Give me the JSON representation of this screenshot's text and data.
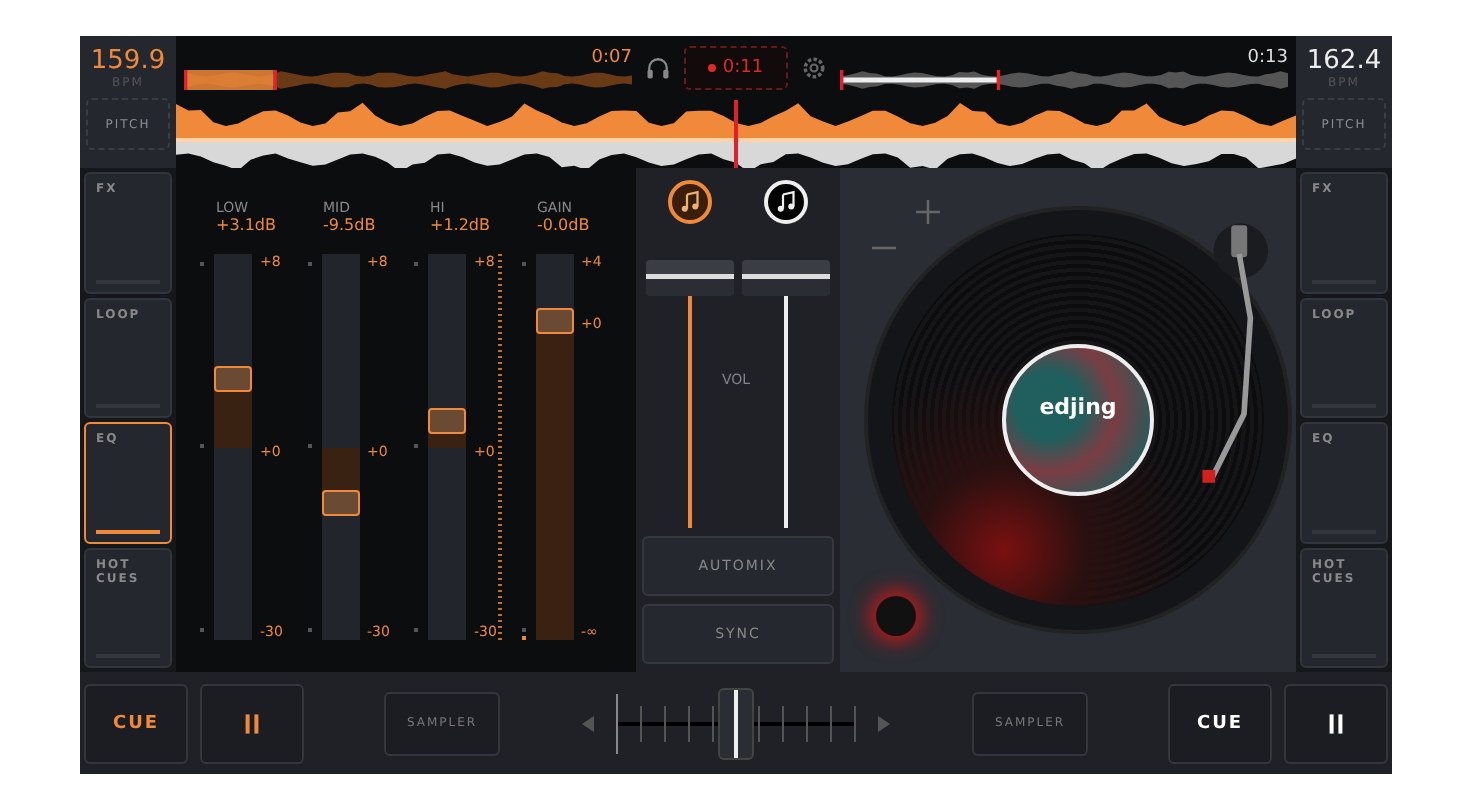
{
  "deck_a": {
    "bpm": "159.9",
    "bpm_unit": "BPM",
    "pitch": "PITCH",
    "time": "0:07",
    "level": 0.2
  },
  "deck_b": {
    "bpm": "162.4",
    "bpm_unit": "BPM",
    "pitch": "PITCH",
    "time": "0:13",
    "level": 0.35
  },
  "record": {
    "time": "0:11"
  },
  "left_tabs": [
    {
      "label": "FX",
      "selected": false
    },
    {
      "label": "LOOP",
      "selected": false
    },
    {
      "label": "EQ",
      "selected": true
    },
    {
      "label": "HOT CUES",
      "selected": false
    }
  ],
  "eq_bands": [
    {
      "kind": "eq",
      "label": "LOW",
      "value": "+3.1dB",
      "level": 0.68,
      "scale": [
        "+8",
        "+0",
        "-30"
      ]
    },
    {
      "kind": "eq",
      "label": "MID",
      "value": "-9.5dB",
      "level": 0.36,
      "scale": [
        "+8",
        "+0",
        "-30"
      ]
    },
    {
      "kind": "eq",
      "label": "HI",
      "value": "+1.2dB",
      "level": 0.57,
      "scale": [
        "+8",
        "+0",
        "-30"
      ]
    },
    {
      "kind": "gain",
      "label": "GAIN",
      "value": "-0.0dB",
      "level": 0.83,
      "scale": [
        "+4",
        "+0",
        "-∞"
      ]
    }
  ],
  "mixer": {
    "vol_label": "VOL",
    "channels": [
      {
        "level": 0.97,
        "selected": true
      },
      {
        "level": 0.97,
        "selected": false
      }
    ],
    "buttons": [
      "AUTOMIX",
      "SYNC"
    ]
  },
  "record_label": {
    "logo": "edjing"
  },
  "right_tabs": [
    {
      "label": "FX",
      "selected": false
    },
    {
      "label": "LOOP",
      "selected": false
    },
    {
      "label": "EQ",
      "selected": false
    },
    {
      "label": "HOT CUES",
      "selected": false
    }
  ],
  "bottom": {
    "deck_a": {
      "cue": "CUE"
    },
    "sampler_a": "SAMPLER",
    "crossfader": {
      "level": 0.5
    },
    "sampler_b": "SAMPLER",
    "deck_b": {
      "cue": "CUE"
    }
  }
}
